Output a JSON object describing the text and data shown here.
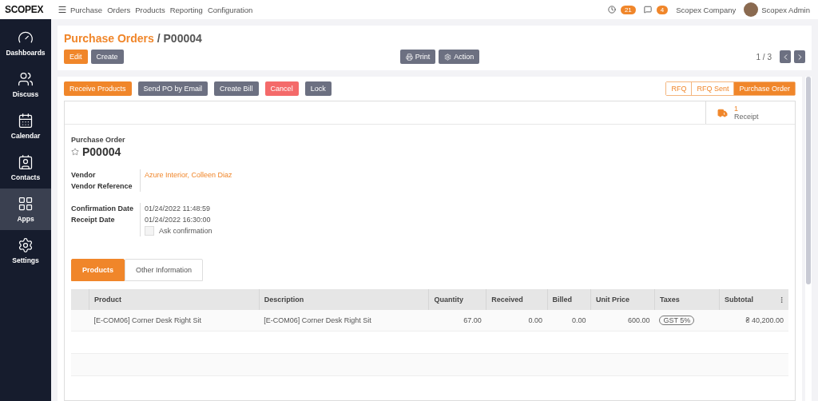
{
  "logo": "SCOPEX",
  "topbar": {
    "app": "Purchase",
    "menu": [
      "Orders",
      "Products",
      "Reporting",
      "Configuration"
    ],
    "activity_count": "21",
    "message_count": "4",
    "company": "Scopex Company",
    "user": "Scopex Admin"
  },
  "sidebar": {
    "items": [
      {
        "label": "Dashboards",
        "kind": "gauge",
        "selected": false
      },
      {
        "label": "Discuss",
        "kind": "people",
        "selected": false
      },
      {
        "label": "Calendar",
        "kind": "calendar",
        "selected": false
      },
      {
        "label": "Contacts",
        "kind": "contact",
        "selected": false
      },
      {
        "label": "Apps",
        "kind": "grid",
        "selected": true
      },
      {
        "label": "Settings",
        "kind": "gear",
        "selected": false
      }
    ]
  },
  "breadcrumb": {
    "parent": "Purchase Orders",
    "separator": "/",
    "current": "P00004"
  },
  "control_buttons": [
    {
      "label": "Edit",
      "kind": "primary"
    },
    {
      "label": "Create",
      "kind": "secondary"
    }
  ],
  "center_buttons": [
    {
      "label": "Print",
      "kind": "print"
    },
    {
      "label": "Action",
      "kind": "gear"
    }
  ],
  "pager": {
    "text": "1 / 3"
  },
  "action_buttons": [
    {
      "label": "Receive Products",
      "kind": "primary"
    },
    {
      "label": "Send PO by Email",
      "kind": "secondary"
    },
    {
      "label": "Create Bill",
      "kind": "secondary"
    },
    {
      "label": "Cancel",
      "kind": "danger"
    },
    {
      "label": "Lock",
      "kind": "secondary"
    }
  ],
  "statusbar": [
    {
      "label": "RFQ",
      "selected": false
    },
    {
      "label": "RFQ Sent",
      "selected": false
    },
    {
      "label": "Purchase Order",
      "selected": true
    }
  ],
  "smart_button": {
    "count": "1",
    "label": "Receipt"
  },
  "form": {
    "caption": "Purchase Order",
    "name": "P00004",
    "starred": false,
    "groups": [
      [
        {
          "label": "Vendor",
          "value": "Azure Interior, Colleen Diaz",
          "kind": "link"
        },
        {
          "label": "Vendor Reference",
          "kind": "empty"
        }
      ],
      [
        {
          "label": "Confirmation Date",
          "value": "01/24/2022 11:48:59",
          "kind": "text"
        },
        {
          "label": "Receipt Date",
          "value": "01/24/2022 16:30:00",
          "kind": "text"
        },
        {
          "label": "Ask confirmation",
          "kind": "checkbox",
          "checked": false
        }
      ]
    ]
  },
  "tabs": [
    {
      "label": "Products",
      "selected": true
    },
    {
      "label": "Other Information",
      "selected": false
    }
  ],
  "table": {
    "columns": [
      "Product",
      "Description",
      "Quantity",
      "Received",
      "Billed",
      "Unit Price",
      "Taxes",
      "Subtotal"
    ],
    "rows": [
      {
        "cells": [
          "[E-COM06] Corner Desk Right Sit",
          "[E-COM06] Corner Desk Right Sit",
          "67.00",
          "0.00",
          "0.00",
          "600.00",
          "GST 5%",
          "₴ 40,200.00"
        ]
      }
    ]
  }
}
